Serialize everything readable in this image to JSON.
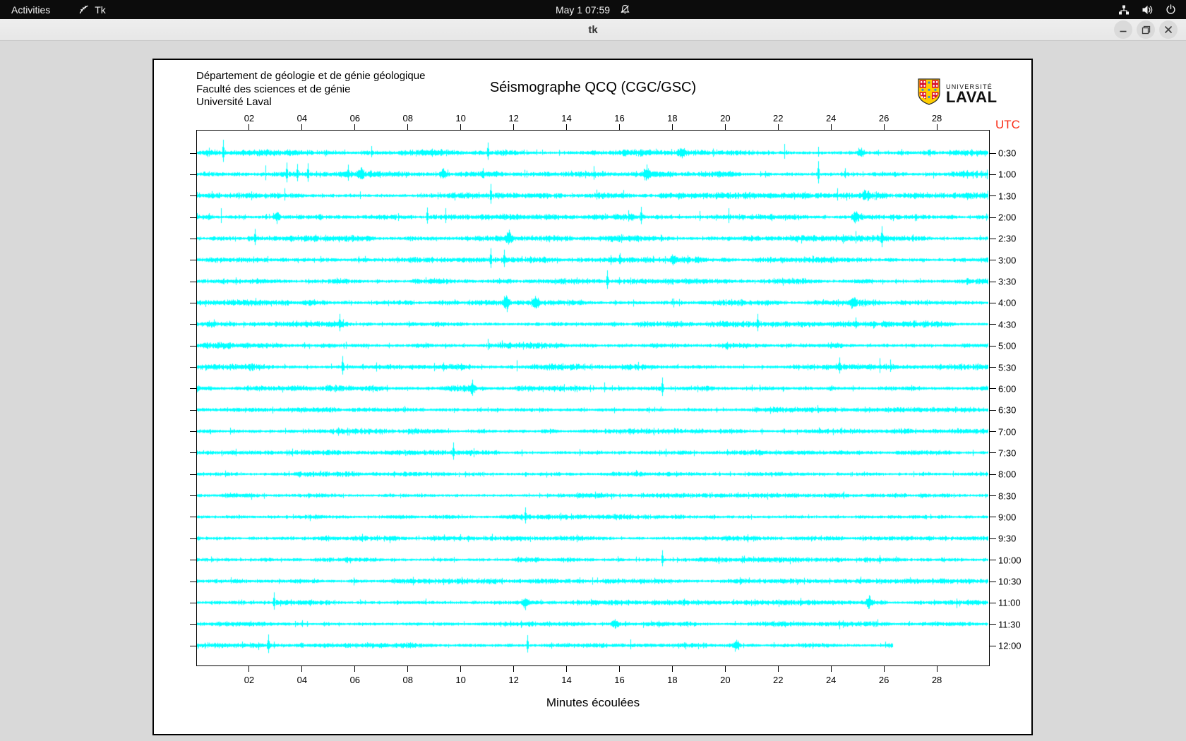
{
  "topbar": {
    "activities_label": "Activities",
    "app_name": "Tk",
    "clock": "May 1 07:59",
    "status_icons": [
      "notifications-disabled",
      "network-wired",
      "volume-on",
      "power"
    ]
  },
  "titlebar": {
    "title": "tk",
    "window_controls": [
      "minimize",
      "maximize",
      "close"
    ]
  },
  "sheet": {
    "institution_lines": [
      "Département de géologie et de génie géologique",
      "Faculté des sciences et de génie",
      "Université Laval"
    ],
    "title": "Séismographe QCQ (CGC/GSC)",
    "logo": {
      "small_text": "UNIVERSITÉ",
      "large_text": "LAVAL"
    },
    "utc_label": "UTC",
    "xlabel": "Minutes écoulées"
  },
  "colors": {
    "trace": "#00ffff",
    "utc_red": "#f92c16",
    "logo_red": "#d8112d",
    "logo_gold": "#ffcd00",
    "logo_blue": "#2b8fd8"
  },
  "chart_data": {
    "type": "line",
    "title": "Séismographe QCQ (CGC/GSC)",
    "xlabel": "Minutes écoulées",
    "x_range_minutes": [
      0,
      30
    ],
    "x_ticks": [
      "02",
      "04",
      "06",
      "08",
      "10",
      "12",
      "14",
      "16",
      "18",
      "20",
      "22",
      "24",
      "26",
      "28"
    ],
    "y_axis_side": "right",
    "y_unit": "UTC",
    "grid": false,
    "rows": [
      {
        "label": "0:30",
        "events": [
          {
            "m": 1.0,
            "a": 18,
            "t": "s"
          },
          {
            "m": 6.6,
            "a": 9,
            "t": "s"
          },
          {
            "m": 11.0,
            "a": 14,
            "t": "s"
          },
          {
            "m": 18.3,
            "a": 6,
            "t": "b"
          },
          {
            "m": 22.2,
            "a": 12,
            "t": "s"
          },
          {
            "m": 23.5,
            "a": 8,
            "t": "s"
          },
          {
            "m": 25.1,
            "a": 6,
            "t": "b"
          }
        ]
      },
      {
        "label": "1:00",
        "events": [
          {
            "m": 2.6,
            "a": 12,
            "t": "s"
          },
          {
            "m": 3.4,
            "a": 16,
            "t": "s"
          },
          {
            "m": 3.8,
            "a": 14,
            "t": "s"
          },
          {
            "m": 4.2,
            "a": 15,
            "t": "s"
          },
          {
            "m": 5.7,
            "a": 13,
            "t": "s"
          },
          {
            "m": 6.2,
            "a": 6,
            "t": "b"
          },
          {
            "m": 9.3,
            "a": 7,
            "t": "b"
          },
          {
            "m": 10.8,
            "a": 8,
            "t": "s"
          },
          {
            "m": 15.0,
            "a": 11,
            "t": "s"
          },
          {
            "m": 17.0,
            "a": 7,
            "t": "b"
          },
          {
            "m": 23.5,
            "a": 18,
            "t": "s"
          },
          {
            "m": 24.5,
            "a": 8,
            "t": "s"
          }
        ]
      },
      {
        "label": "1:30",
        "events": [
          {
            "m": 3.3,
            "a": 10,
            "t": "s"
          },
          {
            "m": 11.1,
            "a": 16,
            "t": "s"
          },
          {
            "m": 15.1,
            "a": 8,
            "t": "s"
          },
          {
            "m": 24.2,
            "a": 10,
            "t": "s"
          },
          {
            "m": 25.3,
            "a": 7,
            "t": "b"
          }
        ]
      },
      {
        "label": "2:00",
        "events": [
          {
            "m": 0.9,
            "a": 12,
            "t": "s"
          },
          {
            "m": 3.0,
            "a": 6,
            "t": "b"
          },
          {
            "m": 8.7,
            "a": 13,
            "t": "s"
          },
          {
            "m": 9.4,
            "a": 12,
            "t": "s"
          },
          {
            "m": 16.3,
            "a": 9,
            "t": "s"
          },
          {
            "m": 16.8,
            "a": 14,
            "t": "s"
          },
          {
            "m": 19.0,
            "a": 8,
            "t": "s"
          },
          {
            "m": 20.1,
            "a": 12,
            "t": "s"
          },
          {
            "m": 24.9,
            "a": 6,
            "t": "b"
          }
        ]
      },
      {
        "label": "2:30",
        "events": [
          {
            "m": 2.2,
            "a": 13,
            "t": "s"
          },
          {
            "m": 11.8,
            "a": 7,
            "t": "b"
          },
          {
            "m": 24.9,
            "a": 10,
            "t": "s"
          },
          {
            "m": 25.9,
            "a": 17,
            "t": "s"
          }
        ]
      },
      {
        "label": "3:00",
        "events": [
          {
            "m": 11.1,
            "a": 16,
            "t": "s"
          },
          {
            "m": 11.6,
            "a": 14,
            "t": "s"
          },
          {
            "m": 16.0,
            "a": 9,
            "t": "s"
          },
          {
            "m": 18.0,
            "a": 6,
            "t": "b"
          }
        ]
      },
      {
        "label": "3:30",
        "events": [
          {
            "m": 15.5,
            "a": 15,
            "t": "s"
          }
        ]
      },
      {
        "label": "4:00",
        "events": [
          {
            "m": 11.7,
            "a": 10,
            "t": "b"
          },
          {
            "m": 12.8,
            "a": 7,
            "t": "b"
          },
          {
            "m": 24.8,
            "a": 6,
            "t": "b"
          }
        ]
      },
      {
        "label": "4:30",
        "events": [
          {
            "m": 5.4,
            "a": 14,
            "t": "s"
          },
          {
            "m": 21.2,
            "a": 14,
            "t": "s"
          },
          {
            "m": 24.9,
            "a": 9,
            "t": "s"
          }
        ]
      },
      {
        "label": "5:00",
        "events": [
          {
            "m": 11.0,
            "a": 9,
            "t": "s"
          }
        ]
      },
      {
        "label": "5:30",
        "events": [
          {
            "m": 5.5,
            "a": 15,
            "t": "s"
          },
          {
            "m": 12.1,
            "a": 9,
            "t": "s"
          },
          {
            "m": 24.3,
            "a": 13,
            "t": "s"
          },
          {
            "m": 25.8,
            "a": 12,
            "t": "s"
          },
          {
            "m": 26.2,
            "a": 10,
            "t": "s"
          }
        ]
      },
      {
        "label": "6:00",
        "events": [
          {
            "m": 10.4,
            "a": 7,
            "t": "b"
          },
          {
            "m": 15.4,
            "a": 8,
            "t": "s"
          },
          {
            "m": 17.6,
            "a": 15,
            "t": "s"
          }
        ]
      },
      {
        "label": "6:30",
        "events": []
      },
      {
        "label": "7:00",
        "events": []
      },
      {
        "label": "7:30",
        "events": [
          {
            "m": 9.7,
            "a": 14,
            "t": "s"
          }
        ]
      },
      {
        "label": "8:00",
        "events": []
      },
      {
        "label": "8:30",
        "events": []
      },
      {
        "label": "9:00",
        "events": [
          {
            "m": 12.4,
            "a": 13,
            "t": "s"
          }
        ]
      },
      {
        "label": "9:30",
        "events": []
      },
      {
        "label": "10:00",
        "events": [
          {
            "m": 17.6,
            "a": 13,
            "t": "s"
          }
        ]
      },
      {
        "label": "10:30",
        "events": []
      },
      {
        "label": "11:00",
        "events": [
          {
            "m": 2.9,
            "a": 14,
            "t": "s"
          },
          {
            "m": 12.4,
            "a": 7,
            "t": "b"
          },
          {
            "m": 25.4,
            "a": 7,
            "t": "b"
          }
        ]
      },
      {
        "label": "11:30",
        "events": [
          {
            "m": 15.8,
            "a": 6,
            "t": "b"
          }
        ]
      },
      {
        "label": "12:00",
        "events": [
          {
            "m": 2.7,
            "a": 15,
            "t": "s"
          },
          {
            "m": 12.5,
            "a": 14,
            "t": "s"
          },
          {
            "m": 16.4,
            "a": 8,
            "t": "s"
          },
          {
            "m": 20.4,
            "a": 6,
            "t": "b"
          }
        ],
        "end_minute": 26.3
      }
    ]
  }
}
